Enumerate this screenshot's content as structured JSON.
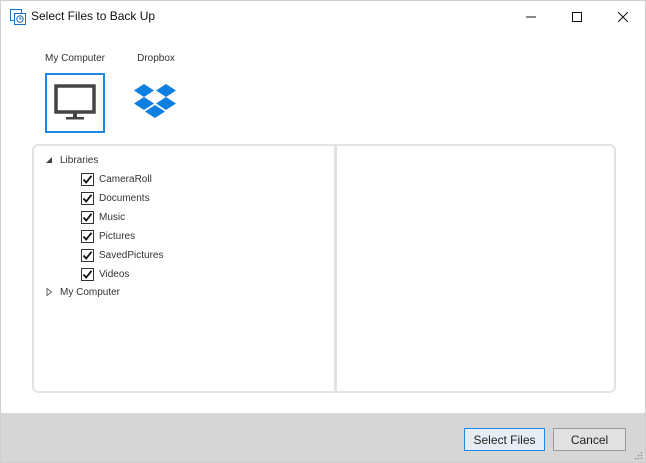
{
  "window": {
    "title": "Select Files to Back Up"
  },
  "sources": [
    {
      "label": "My Computer",
      "icon": "monitor-icon",
      "selected": true
    },
    {
      "label": "Dropbox",
      "icon": "dropbox-icon",
      "selected": false
    }
  ],
  "tree": {
    "libraries": {
      "label": "Libraries",
      "expanded": true,
      "children": [
        {
          "label": "CameraRoll",
          "checked": true
        },
        {
          "label": "Documents",
          "checked": true
        },
        {
          "label": "Music",
          "checked": true
        },
        {
          "label": "Pictures",
          "checked": true
        },
        {
          "label": "SavedPictures",
          "checked": true
        },
        {
          "label": "Videos",
          "checked": true
        }
      ]
    },
    "my_computer": {
      "label": "My Computer",
      "expanded": false
    }
  },
  "footer": {
    "select_label": "Select Files",
    "cancel_label": "Cancel"
  },
  "colors": {
    "accent": "#1e88e5",
    "dropbox": "#0d7fe0",
    "footer_bg": "#d6d6d6"
  }
}
